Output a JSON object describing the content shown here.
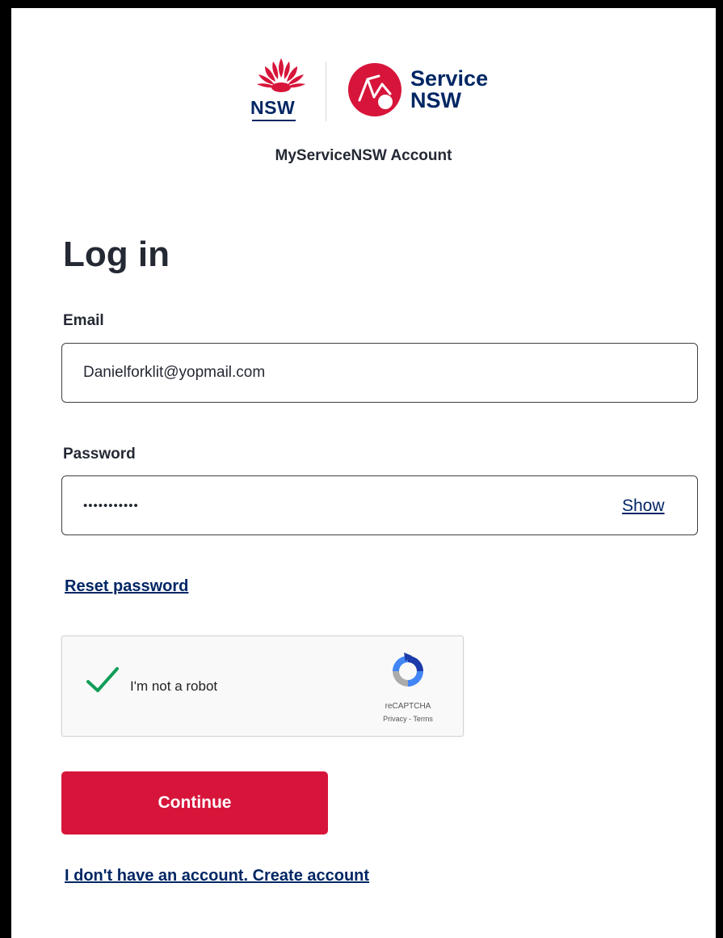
{
  "header": {
    "nsw_logo_text": "NSW",
    "service_logo_line1": "Service",
    "service_logo_line2": "NSW",
    "account_title": "MyServiceNSW Account"
  },
  "form": {
    "heading": "Log in",
    "email_label": "Email",
    "email_value": "Danielforklit@yopmail.com",
    "password_label": "Password",
    "password_value": "•••••••••••",
    "show_label": "Show",
    "reset_password_label": "Reset password",
    "continue_label": "Continue",
    "create_account_label": "I don't have an account. Create account"
  },
  "recaptcha": {
    "checked": true,
    "label": "I'm not a robot",
    "brand": "reCAPTCHA",
    "legal": "Privacy - Terms"
  },
  "colors": {
    "brand_red": "#d7153a",
    "brand_navy": "#002664",
    "text_dark": "#242934",
    "check_green": "#0f9d58"
  },
  "icons": {
    "nsw_logo": "waratah-flower-icon",
    "service_nsw_logo": "service-nsw-circle-icon",
    "captcha_check": "checkmark-icon",
    "captcha_logo": "recaptcha-icon"
  }
}
